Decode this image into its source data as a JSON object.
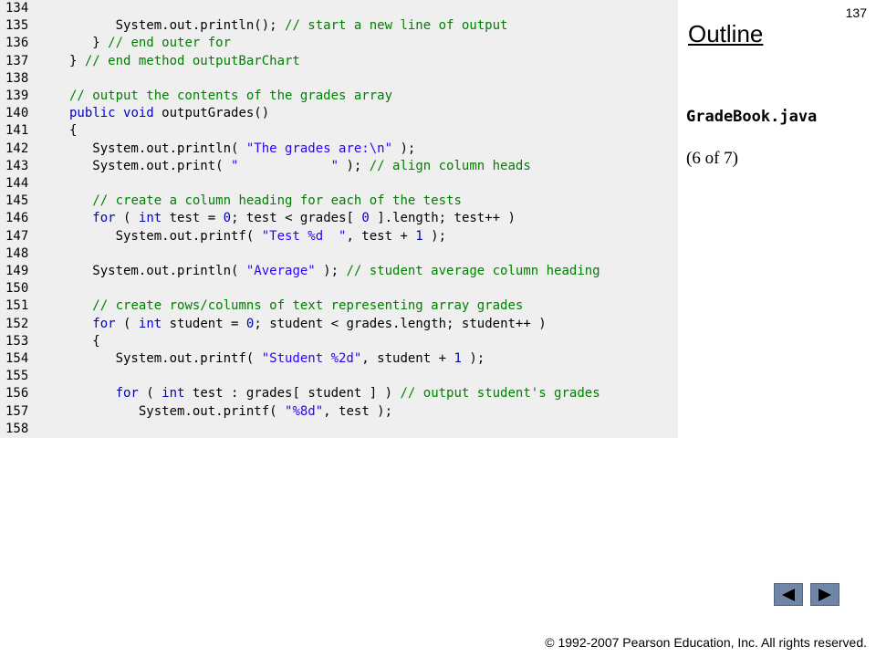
{
  "page_number": "137",
  "outline": {
    "title": "Outline",
    "file_name": "GradeBook.java",
    "part": "(6 of 7)"
  },
  "code_lines": [
    {
      "num": "134",
      "code": ""
    },
    {
      "num": "135",
      "code": "      System.out.println(); // start a new line of output"
    },
    {
      "num": "136",
      "code": "   } // end outer for"
    },
    {
      "num": "137",
      "code": "} // end method outputBarChart"
    },
    {
      "num": "138",
      "code": ""
    },
    {
      "num": "139",
      "code": "// output the contents of the grades array"
    },
    {
      "num": "140",
      "code": "public void outputGrades()"
    },
    {
      "num": "141",
      "code": "{"
    },
    {
      "num": "142",
      "code": "   System.out.println( \"The grades are:\\n\" );"
    },
    {
      "num": "143",
      "code": "   System.out.print( \"            \" ); // align column heads"
    },
    {
      "num": "144",
      "code": ""
    },
    {
      "num": "145",
      "code": "   // create a column heading for each of the tests"
    },
    {
      "num": "146",
      "code": "   for ( int test = 0; test < grades[ 0 ].length; test++ )"
    },
    {
      "num": "147",
      "code": "      System.out.printf( \"Test %d  \", test + 1 );"
    },
    {
      "num": "148",
      "code": ""
    },
    {
      "num": "149",
      "code": "   System.out.println( \"Average\" ); // student average column heading"
    },
    {
      "num": "150",
      "code": ""
    },
    {
      "num": "151",
      "code": "   // create rows/columns of text representing array grades"
    },
    {
      "num": "152",
      "code": "   for ( int student = 0; student < grades.length; student++ )"
    },
    {
      "num": "153",
      "code": "   {"
    },
    {
      "num": "154",
      "code": "      System.out.printf( \"Student %2d\", student + 1 );"
    },
    {
      "num": "155",
      "code": ""
    },
    {
      "num": "156",
      "code": "      for ( int test : grades[ student ] ) // output student's grades"
    },
    {
      "num": "157",
      "code": "         System.out.printf( \"%8d\", test );"
    },
    {
      "num": "158",
      "code": ""
    }
  ],
  "navigation": {
    "prev_icon": "triangle-left-icon",
    "next_icon": "triangle-right-icon",
    "color": "#6f86a6"
  },
  "copyright": "© 1992-2007 Pearson Education, Inc.  All rights reserved."
}
